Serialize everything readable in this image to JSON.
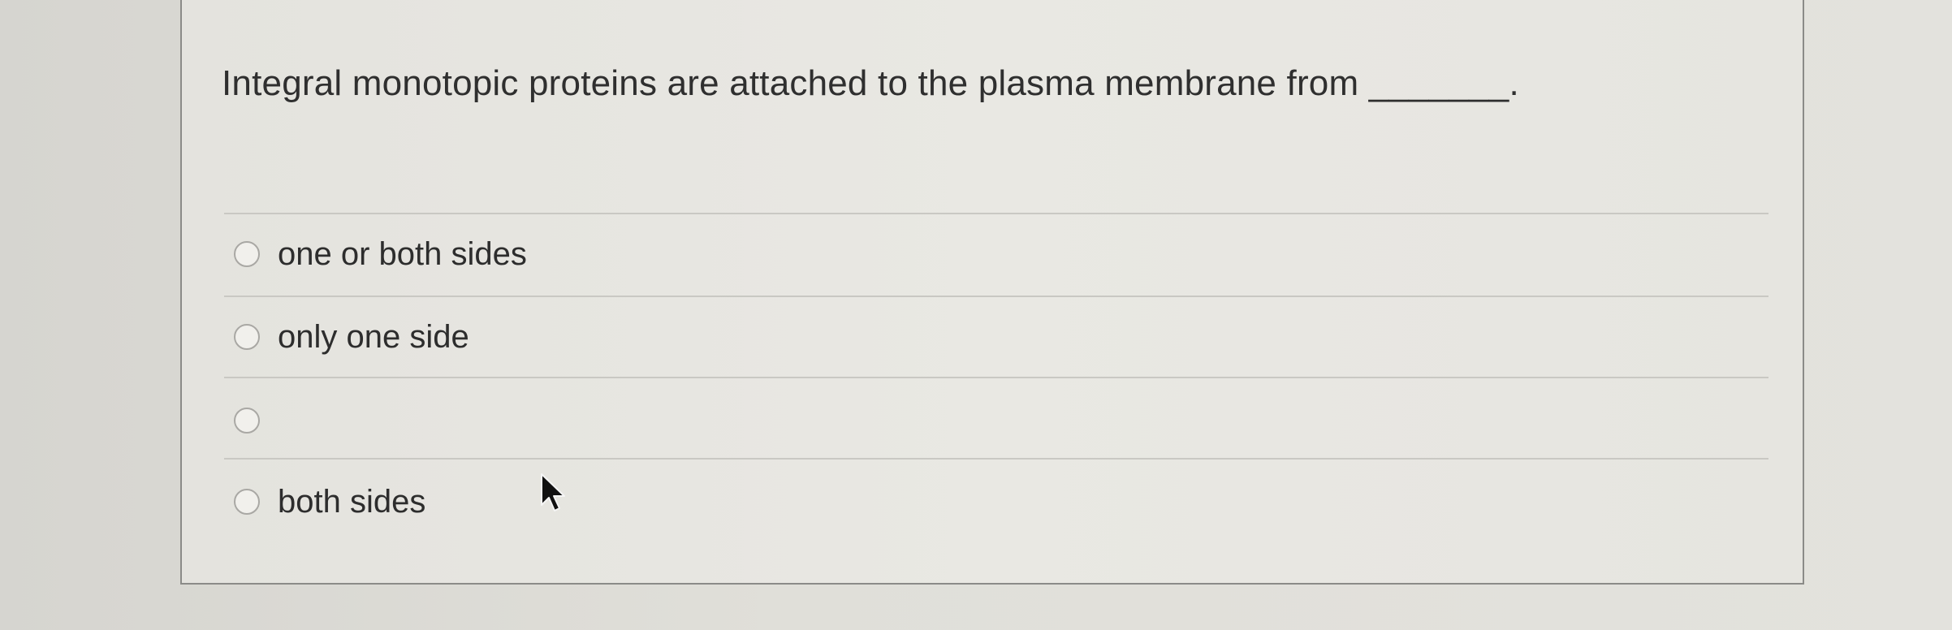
{
  "question": {
    "text": "Integral monotopic proteins are attached to the plasma membrane from _______."
  },
  "options": [
    {
      "label": "one or both sides",
      "selected": false
    },
    {
      "label": "only one side",
      "selected": false
    },
    {
      "label": "",
      "selected": false
    },
    {
      "label": "both sides",
      "selected": false
    }
  ],
  "icons": {
    "pointer": "mouse-pointer-icon",
    "radio": "radio-button-icon"
  }
}
